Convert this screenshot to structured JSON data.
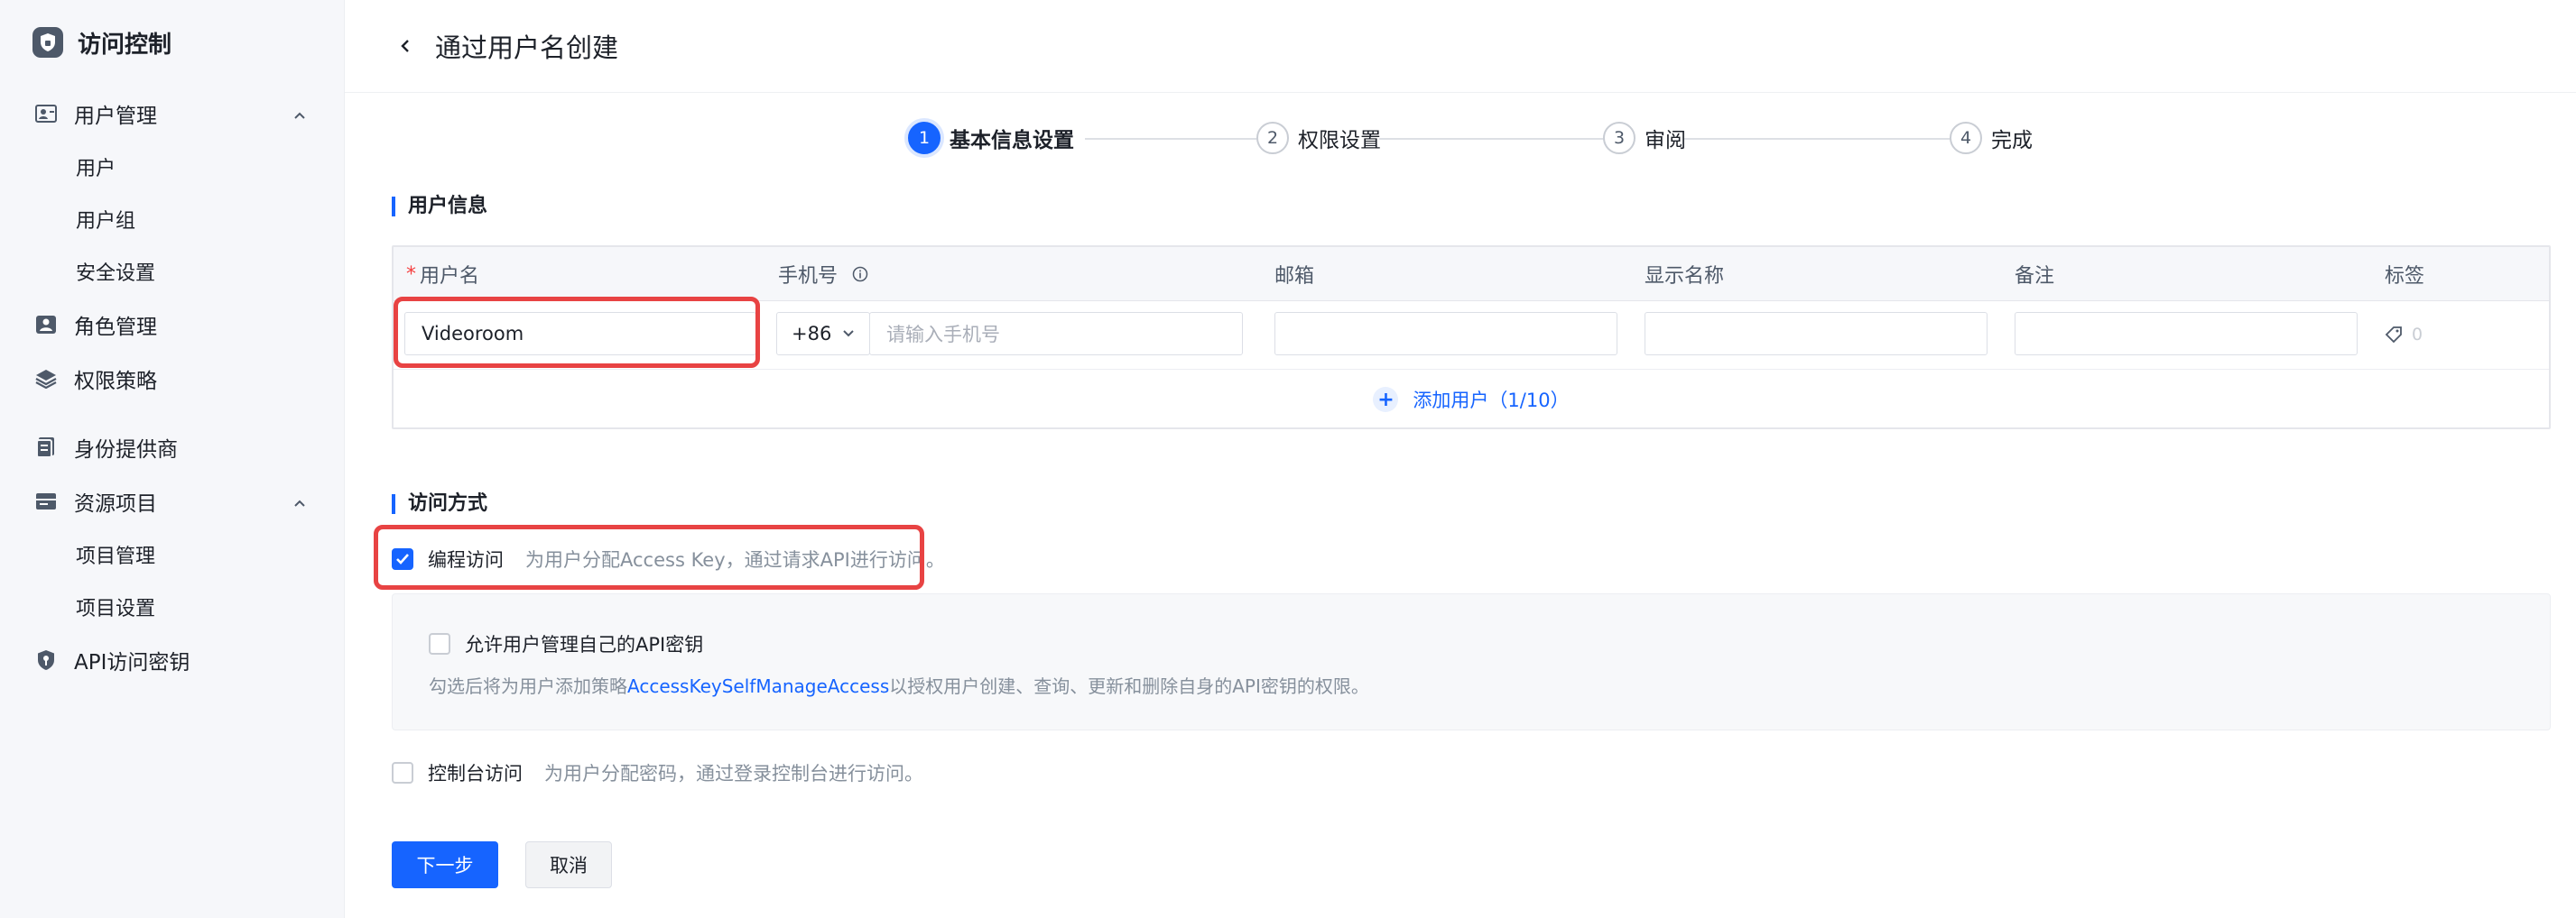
{
  "sidebar": {
    "title": "访问控制",
    "logo_icon": "shield-lock-icon",
    "groups": [
      {
        "label": "用户管理",
        "icon": "user-card-icon",
        "expanded": true,
        "children": [
          "用户",
          "用户组",
          "安全设置"
        ]
      },
      {
        "label": "角色管理",
        "icon": "role-icon"
      },
      {
        "label": "权限策略",
        "icon": "layers-icon"
      },
      {
        "label": "身份提供商",
        "icon": "id-provider-icon"
      },
      {
        "label": "资源项目",
        "icon": "folder-icon",
        "expanded": true,
        "children": [
          "项目管理",
          "项目设置"
        ]
      },
      {
        "label": "API访问密钥",
        "icon": "key-shield-icon"
      }
    ]
  },
  "header": {
    "back_icon": "chevron-left-icon",
    "title": "通过用户名创建"
  },
  "steps": [
    {
      "num": "1",
      "label": "基本信息设置",
      "active": true
    },
    {
      "num": "2",
      "label": "权限设置",
      "active": false
    },
    {
      "num": "3",
      "label": "审阅",
      "active": false
    },
    {
      "num": "4",
      "label": "完成",
      "active": false
    }
  ],
  "user_info": {
    "section_title": "用户信息",
    "columns": {
      "username": "用户名",
      "phone": "手机号",
      "email": "邮箱",
      "display_name": "显示名称",
      "remark": "备注",
      "tags": "标签"
    },
    "required_mark": "*",
    "row": {
      "username": "Videoroom",
      "country_code": "+86",
      "phone_placeholder": "请输入手机号",
      "email": "",
      "display_name": "",
      "remark": "",
      "tag_count": "0"
    },
    "add_user": "添加用户（1/10）"
  },
  "access": {
    "section_title": "访问方式",
    "programmatic": {
      "label": "编程访问",
      "desc": "为用户分配Access Key，通过请求API进行访问。",
      "checked": true
    },
    "api_panel": {
      "allow_label": "允许用户管理自己的API密钥",
      "hint_prefix": "勾选后将为用户添加策略",
      "hint_link": "AccessKeySelfManageAccess",
      "hint_suffix": "以授权用户创建、查询、更新和删除自身的API密钥的权限。"
    },
    "console": {
      "label": "控制台访问",
      "desc": "为用户分配密码，通过登录控制台进行访问。",
      "checked": false
    }
  },
  "buttons": {
    "next": "下一步",
    "cancel": "取消"
  },
  "colors": {
    "primary": "#1664ff",
    "highlight": "#e84343",
    "required": "#f53f3f"
  }
}
